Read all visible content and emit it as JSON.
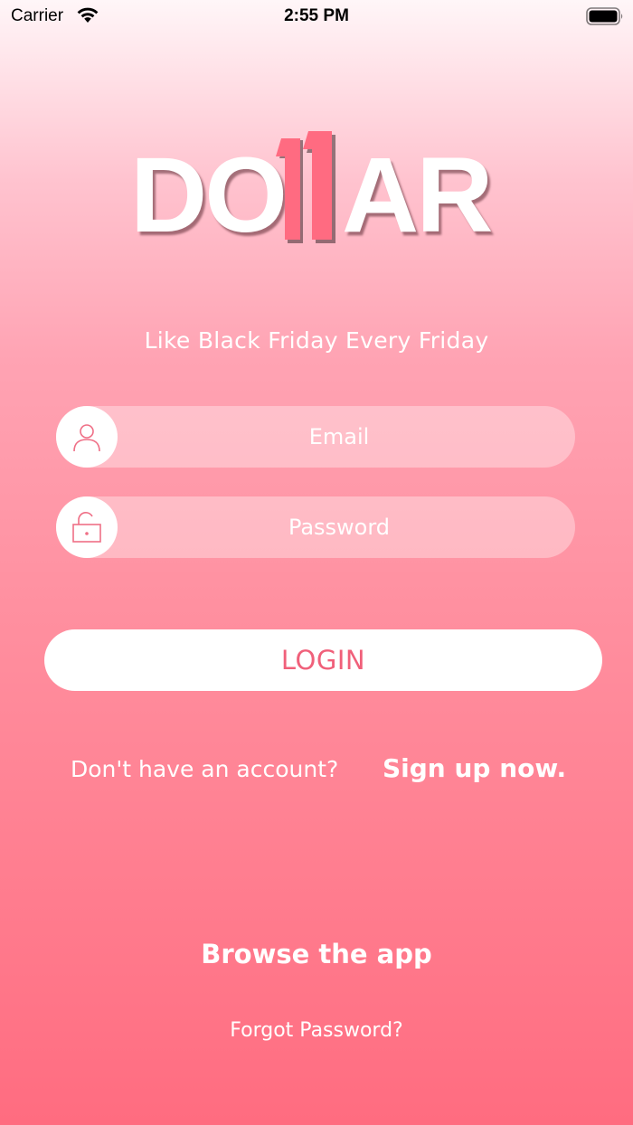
{
  "status_bar": {
    "carrier": "Carrier",
    "time": "2:55 PM",
    "wifi_icon": "wifi-icon",
    "battery_icon": "battery-full-icon"
  },
  "logo": {
    "text_left": "DO",
    "text_right": "AR",
    "ones_color": "#ff6b81"
  },
  "tagline": "Like Black Friday Every Friday",
  "email_field": {
    "placeholder": "Email",
    "value": "",
    "icon": "user-icon"
  },
  "password_field": {
    "placeholder": "Password",
    "value": "",
    "icon": "unlock-icon"
  },
  "login_label": "LOGIN",
  "signup_prompt": "Don't have an account?",
  "signup_link": "Sign up now.",
  "browse_link": "Browse the app",
  "forgot_link": "Forgot Password?",
  "colors": {
    "accent": "#f0607a",
    "background_top": "#fff6f8",
    "background_bottom": "#ff6c80"
  }
}
